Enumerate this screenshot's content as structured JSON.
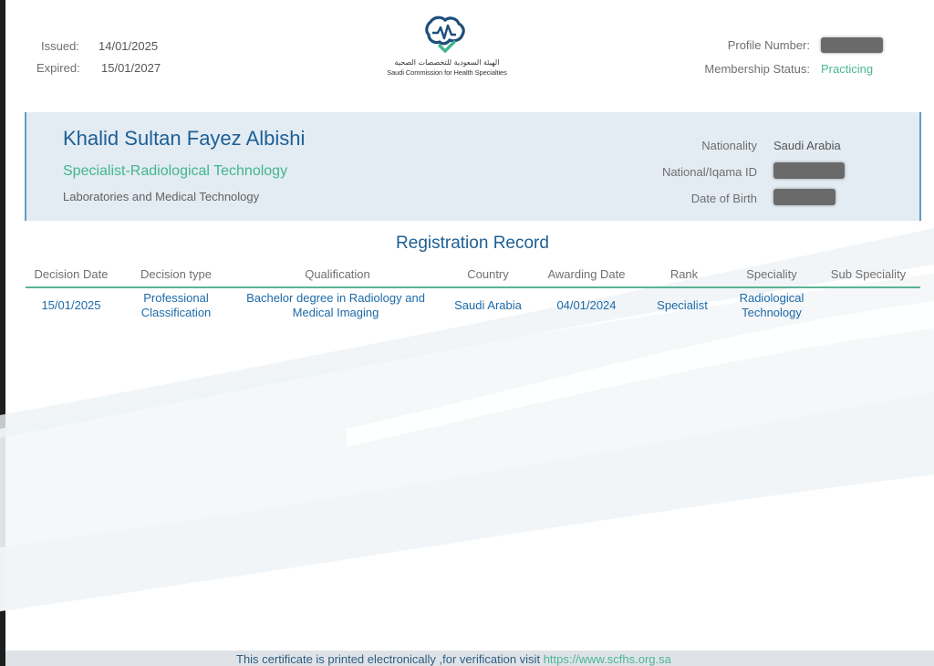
{
  "header": {
    "issued_label": "Issued:",
    "issued_value": "14/01/2025",
    "expired_label": "Expired:",
    "expired_value": "15/01/2027",
    "logo_arabic": "الهيئة السعودية للتخصصات الصحية",
    "logo_english": "Saudi Commission for Health Specialties",
    "profile_number_label": "Profile Number:",
    "membership_status_label": "Membership Status:",
    "membership_status_value": "Practicing"
  },
  "person": {
    "name": "Khalid Sultan Fayez Albishi",
    "title": "Specialist-Radiological Technology",
    "department": "Laboratories and Medical Technology",
    "nationality_label": "Nationality",
    "nationality_value": "Saudi Arabia",
    "national_id_label": "National/Iqama ID",
    "dob_label": "Date of Birth"
  },
  "record": {
    "title": "Registration Record",
    "columns": [
      "Decision Date",
      "Decision type",
      "Qualification",
      "Country",
      "Awarding Date",
      "Rank",
      "Speciality",
      "Sub Speciality"
    ],
    "rows": [
      {
        "decision_date": "15/01/2025",
        "decision_type": [
          "Professional",
          "Classification"
        ],
        "qualification": [
          "Bachelor degree in Radiology and",
          "Medical Imaging"
        ],
        "country": "Saudi Arabia",
        "awarding_date": "04/01/2024",
        "rank": "Specialist",
        "speciality": [
          "Radiological",
          "Technology"
        ],
        "sub_speciality": ""
      }
    ]
  },
  "footer": {
    "text": "This certificate is printed electronically ,for verification visit",
    "link": "https://www.scfhs.org.sa"
  },
  "colors": {
    "brand_blue": "#1d5f95",
    "brand_green": "#42b58f",
    "panel_bg": "#e3ebf3"
  }
}
